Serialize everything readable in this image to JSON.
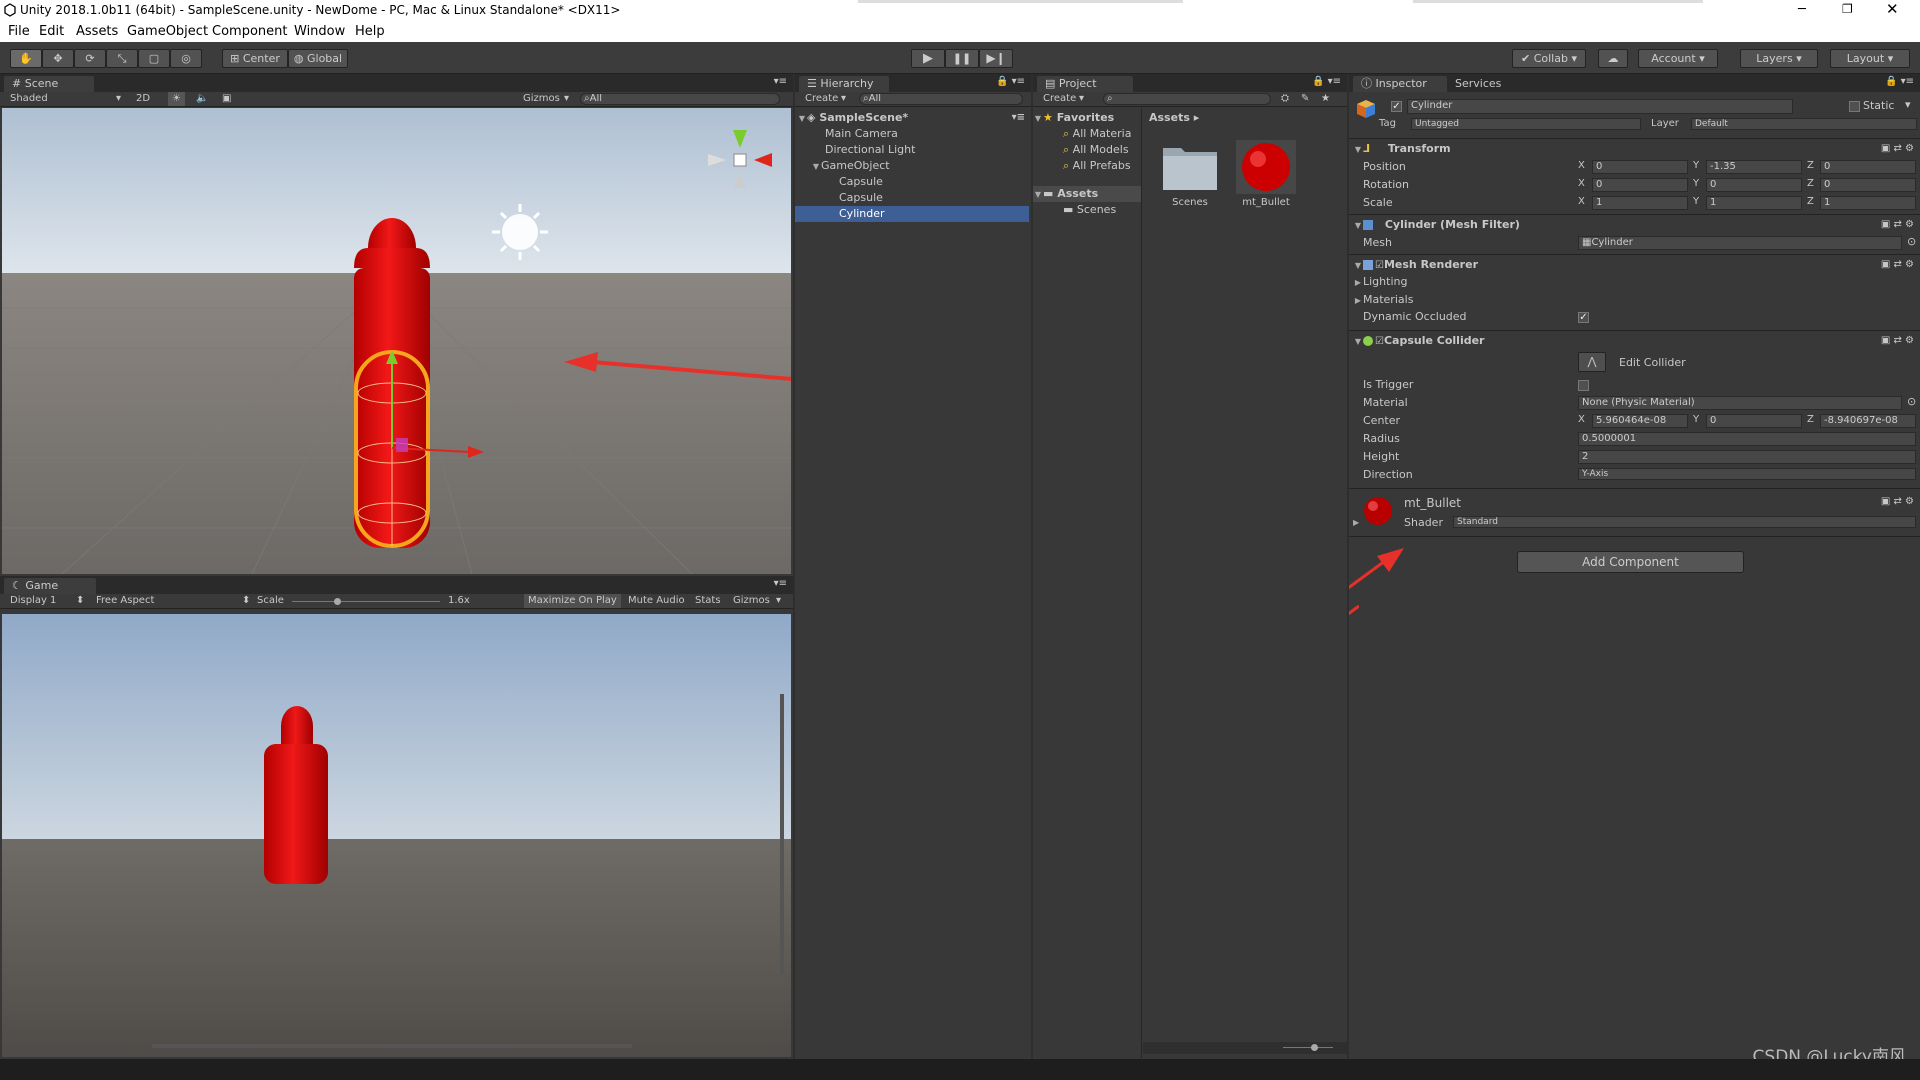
{
  "window": {
    "title": "Unity 2018.1.0b11 (64bit) - SampleScene.unity - NewDome - PC, Mac & Linux Standalone* <DX11>"
  },
  "menu": [
    "File",
    "Edit",
    "Assets",
    "GameObject",
    "Component",
    "Window",
    "Help"
  ],
  "toolbar": {
    "center": "Center",
    "global": "Global",
    "collab": "Collab",
    "account": "Account",
    "layers": "Layers",
    "layout": "Layout"
  },
  "scene": {
    "tab": "Scene",
    "shaded": "Shaded",
    "mode2d": "2D",
    "gizmos": "Gizmos",
    "search": "All"
  },
  "game": {
    "tab": "Game",
    "display": "Display 1",
    "aspect": "Free Aspect",
    "scale_label": "Scale",
    "scale_value": "1.6x",
    "maximize": "Maximize On Play",
    "mute": "Mute Audio",
    "stats": "Stats",
    "gizmos": "Gizmos"
  },
  "hierarchy": {
    "tab": "Hierarchy",
    "create": "Create",
    "search": "All",
    "scene": "SampleScene*",
    "items": [
      "Main Camera",
      "Directional Light",
      "GameObject",
      "Capsule",
      "Capsule",
      "Cylinder"
    ]
  },
  "project": {
    "tab": "Project",
    "create": "Create",
    "favorites": "Favorites",
    "fav_items": [
      "All Materia",
      "All Models",
      "All Prefabs"
    ],
    "assets": "Assets",
    "folders": [
      "Scenes"
    ],
    "path": "Assets",
    "grid": [
      "Scenes",
      "mt_Bullet"
    ]
  },
  "inspector": {
    "tabs": [
      "Inspector",
      "Services"
    ],
    "object_name": "Cylinder",
    "static_label": "Static",
    "tag_label": "Tag",
    "tag_value": "Untagged",
    "layer_label": "Layer",
    "layer_value": "Default",
    "transform": {
      "title": "Transform",
      "rows": [
        {
          "label": "Position",
          "x": "0",
          "y": "-1.35",
          "z": "0"
        },
        {
          "label": "Rotation",
          "x": "0",
          "y": "0",
          "z": "0"
        },
        {
          "label": "Scale",
          "x": "1",
          "y": "1",
          "z": "1"
        }
      ]
    },
    "mesh_filter": {
      "title": "Cylinder (Mesh Filter)",
      "mesh_label": "Mesh",
      "mesh_value": "Cylinder"
    },
    "mesh_renderer": {
      "title": "Mesh Renderer",
      "lighting": "Lighting",
      "materials": "Materials",
      "dynamic_occluded": "Dynamic Occluded"
    },
    "capsule_collider": {
      "title": "Capsule Collider",
      "edit_collider": "Edit Collider",
      "is_trigger": "Is Trigger",
      "material_label": "Material",
      "material_value": "None (Physic Material)",
      "center_label": "Center",
      "center_x": "5.960464e-08",
      "center_y": "0",
      "center_z": "-8.940697e-08",
      "radius_label": "Radius",
      "radius_value": "0.5000001",
      "height_label": "Height",
      "height_value": "2",
      "direction_label": "Direction",
      "direction_value": "Y-Axis"
    },
    "material": {
      "name": "mt_Bullet",
      "shader_label": "Shader",
      "shader_value": "Standard"
    },
    "add_component": "Add Component",
    "axis": {
      "x": "X",
      "y": "Y",
      "z": "Z"
    }
  },
  "watermark": "CSDN @Lucky南风"
}
